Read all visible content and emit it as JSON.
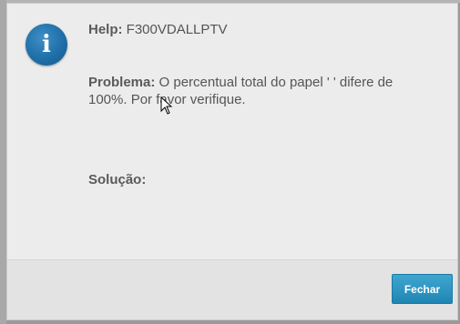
{
  "dialog": {
    "icon": "info-icon",
    "help": {
      "label": "Help:",
      "value": "F300VDALLPTV"
    },
    "problem": {
      "label": "Problema:",
      "value": "O percentual total do papel ' ' difere de 100%. Por favor verifique."
    },
    "solution": {
      "label": "Solução:",
      "value": ""
    },
    "close_label": "Fechar"
  },
  "colors": {
    "accent": "#2a93c1",
    "icon_blue": "#1f6fa8",
    "text": "#555555"
  }
}
